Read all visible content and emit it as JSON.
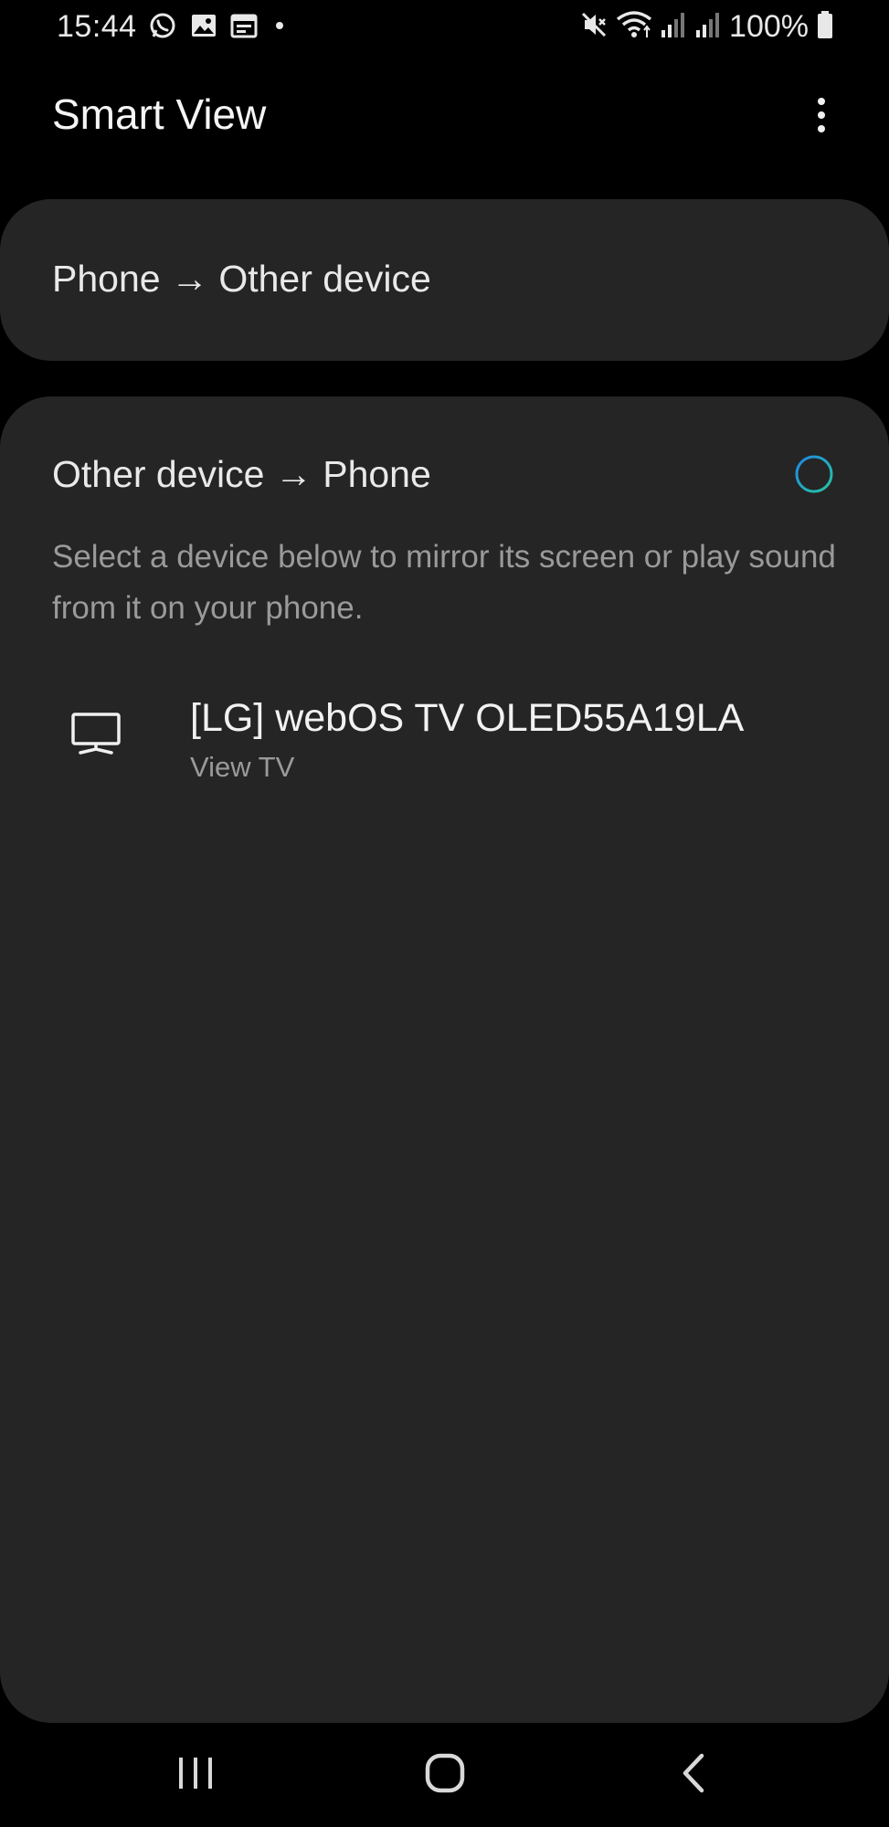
{
  "status_bar": {
    "time": "15:44",
    "battery": "100%",
    "left_icons": [
      "whatsapp-icon",
      "gallery-icon",
      "calendar-icon",
      "notification-dot-icon"
    ],
    "right_icons": [
      "mute-icon",
      "wifi-icon",
      "signal-icon",
      "signal-icon",
      "battery-icon"
    ]
  },
  "app_bar": {
    "title": "Smart View",
    "more_icon": "more-options-icon"
  },
  "cards": {
    "phone_to_other": {
      "title": "Phone → Other device"
    },
    "other_to_phone": {
      "title": "Other device → Phone",
      "description": "Select a device below to mirror its screen or play sound from it on your phone.",
      "devices": [
        {
          "name": "[LG] webOS TV OLED55A19LA",
          "type": "View TV",
          "icon": "tv-icon"
        }
      ]
    }
  },
  "colors": {
    "background": "#000000",
    "card": "#252525",
    "secondary_text": "#9a9a9a",
    "ring_start": "#1e88e5",
    "ring_end": "#26c6a0"
  },
  "nav_bar": {
    "icons": [
      "recents-icon",
      "home-icon",
      "back-icon"
    ]
  }
}
